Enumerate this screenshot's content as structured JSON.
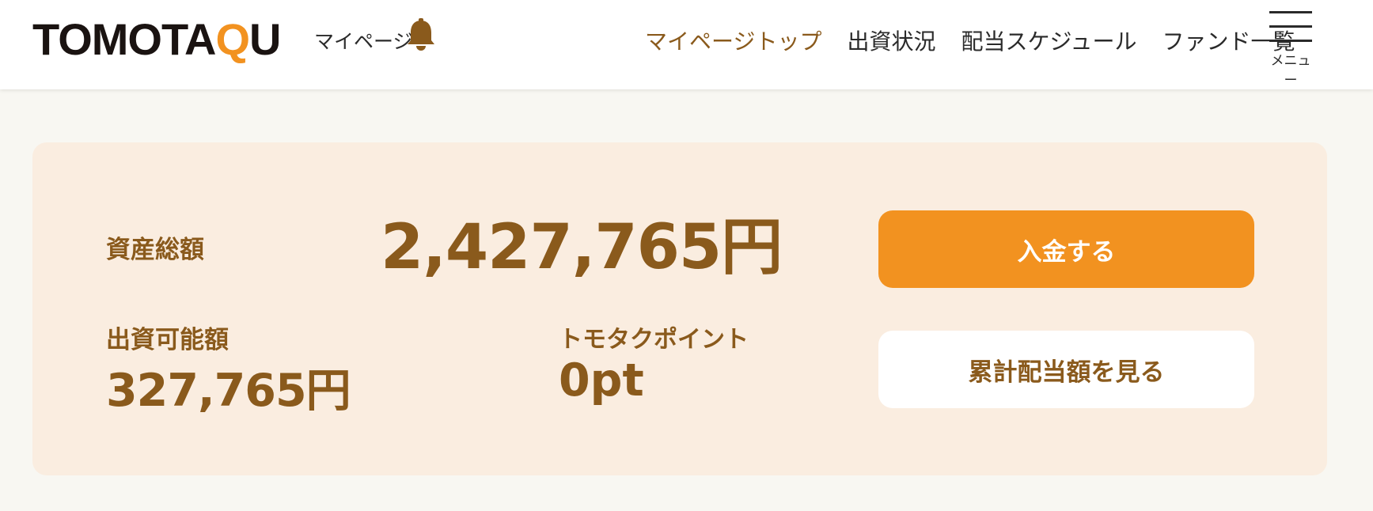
{
  "header": {
    "logo": {
      "part1": "TOMOTA",
      "part2": "Q",
      "part3": "U"
    },
    "mypage_label": "マイページ",
    "nav": [
      {
        "label": "マイページトップ",
        "active": true
      },
      {
        "label": "出資状況",
        "active": false
      },
      {
        "label": "配当スケジュール",
        "active": false
      },
      {
        "label": "ファンド一覧",
        "active": false
      }
    ],
    "menu_label": "メニュー",
    "icons": {
      "bell": "bell-icon",
      "menu": "hamburger-menu-icon"
    }
  },
  "summary": {
    "total_label": "資産総額",
    "total_value": "2,427,765円",
    "available_label": "出資可能額",
    "available_value": "327,765円",
    "points_label": "トモタクポイント",
    "points_value": "0pt"
  },
  "actions": {
    "deposit_label": "入金する",
    "dividend_label": "累計配当額を見る"
  },
  "colors": {
    "accent": "#f29220",
    "brown": "#8a5a1c",
    "card_bg": "#faede0",
    "page_bg": "#f8f7f2"
  }
}
